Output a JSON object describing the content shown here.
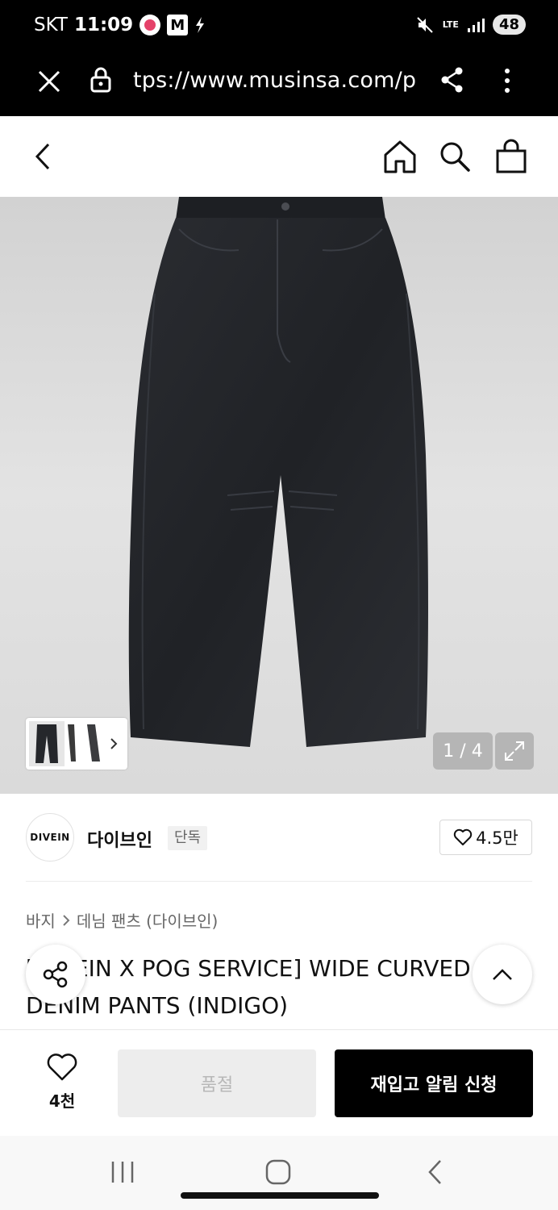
{
  "status_bar": {
    "carrier": "SKT",
    "time": "11:09",
    "app_m": "M",
    "network": "LTE",
    "battery": "48"
  },
  "browser": {
    "url": "tps://www.musinsa.com/p"
  },
  "gallery": {
    "counter": "1 / 4"
  },
  "brand": {
    "logo_text": "DIVEIN",
    "name": "다이브인",
    "badge": "단독",
    "likes": "4.5만"
  },
  "product": {
    "breadcrumb": [
      "바지",
      "데님 팬츠 (다이브인)"
    ],
    "title": "[DIVEIN X POG SERVICE] WIDE CURVED DENIM PANTS (INDIGO)"
  },
  "buy_bar": {
    "wish_count": "4천",
    "soldout_label": "품절",
    "restock_label": "재입고 알림 신청"
  },
  "colors": {
    "accent": "#000000",
    "disabled_bg": "#ededed",
    "jeans": "#25272b"
  }
}
